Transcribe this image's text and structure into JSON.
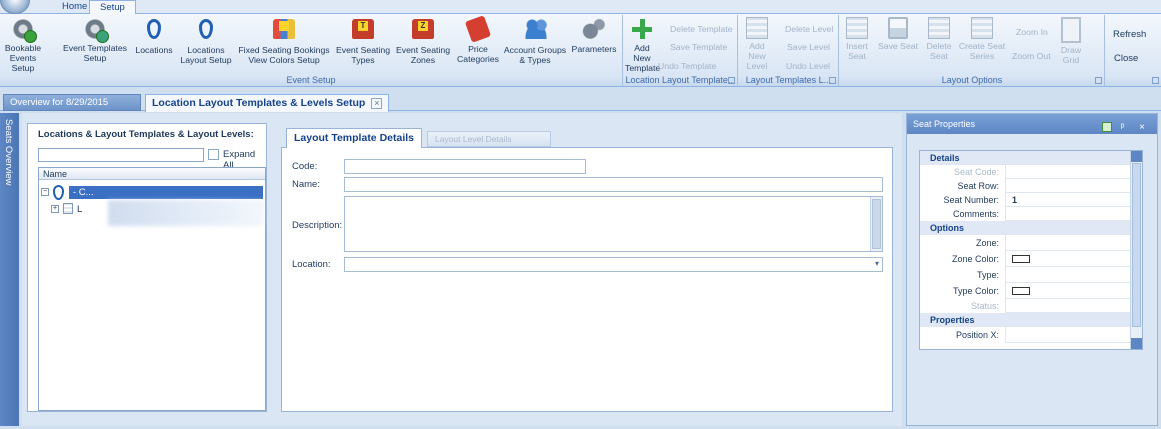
{
  "ribbon_tabs": [
    "Home",
    "Setup"
  ],
  "ribbon": {
    "event_setup": {
      "label": "Event Setup",
      "buttons": [
        {
          "l1": "Bookable",
          "l2": "Events Setup",
          "icon": "gear-b-icon"
        },
        {
          "l1": "Event Templates",
          "l2": "Setup",
          "icon": "gear-t-icon"
        },
        {
          "l1": "Locations",
          "l2": "",
          "icon": "location-pin-icon"
        },
        {
          "l1": "Locations",
          "l2": "Layout Setup",
          "icon": "location-layout-icon"
        },
        {
          "l1": "Fixed Seating Bookings",
          "l2": "View Colors Setup",
          "icon": "seat-colors-icon"
        },
        {
          "l1": "Event Seating",
          "l2": "Types",
          "icon": "seat-type-icon"
        },
        {
          "l1": "Event Seating",
          "l2": "Zones",
          "icon": "seat-zone-icon"
        },
        {
          "l1": "Price",
          "l2": "Categories",
          "icon": "price-tag-icon"
        },
        {
          "l1": "Account Groups",
          "l2": "& Types",
          "icon": "people-icon"
        },
        {
          "l1": "Parameters",
          "l2": "",
          "icon": "gears-icon"
        }
      ]
    },
    "location_layout_template": {
      "label": "Location Layout Template...",
      "add_new": {
        "l1": "Add New",
        "l2": "Template"
      },
      "delete": "Delete Template",
      "save": "Save Template",
      "undo": "Undo Template"
    },
    "layout_templates_levels": {
      "label": "Layout Templates L...",
      "add_new": {
        "l1": "Add New",
        "l2": "Level"
      },
      "delete": "Delete Level",
      "save": "Save Level",
      "undo": "Undo Level"
    },
    "layout_options": {
      "label": "Layout Options",
      "insert_seat": {
        "l1": "Insert",
        "l2": "Seat"
      },
      "save_seat": "Save Seat",
      "delete_seat": {
        "l1": "Delete",
        "l2": "Seat"
      },
      "create_seat_series": {
        "l1": "Create Seat",
        "l2": "Series"
      },
      "zoom_in": "Zoom In",
      "zoom_out": "Zoom Out",
      "draw_grid": "Draw Grid"
    },
    "window": {
      "refresh": "Refresh",
      "close": "Close"
    }
  },
  "doc_tabs": {
    "overview": "Overview for 8/29/2015",
    "active": "Location Layout Templates & Levels Setup"
  },
  "side_strip": "Seats Overview",
  "left_panel": {
    "title": "Locations & Layout Templates & Layout Levels:",
    "expand_all": "Expand All",
    "column": "Name",
    "node1": "- C...",
    "node2": "L"
  },
  "details": {
    "tab_active": "Layout Template Details",
    "tab_disabled": "Layout Level Details",
    "code_label": "Code:",
    "name_label": "Name:",
    "description_label": "Description:",
    "location_label": "Location:"
  },
  "seat_properties": {
    "title": "Seat Properties",
    "sections": {
      "details": "Details",
      "options": "Options",
      "properties": "Properties"
    },
    "rows": {
      "seat_code": "Seat Code:",
      "seat_row": "Seat Row:",
      "seat_number": "Seat Number:",
      "seat_number_value": "1",
      "comments": "Comments:",
      "zone": "Zone:",
      "zone_color": "Zone Color:",
      "type": "Type:",
      "type_color": "Type Color:",
      "status": "Status:",
      "position_x": "Position X:"
    }
  }
}
